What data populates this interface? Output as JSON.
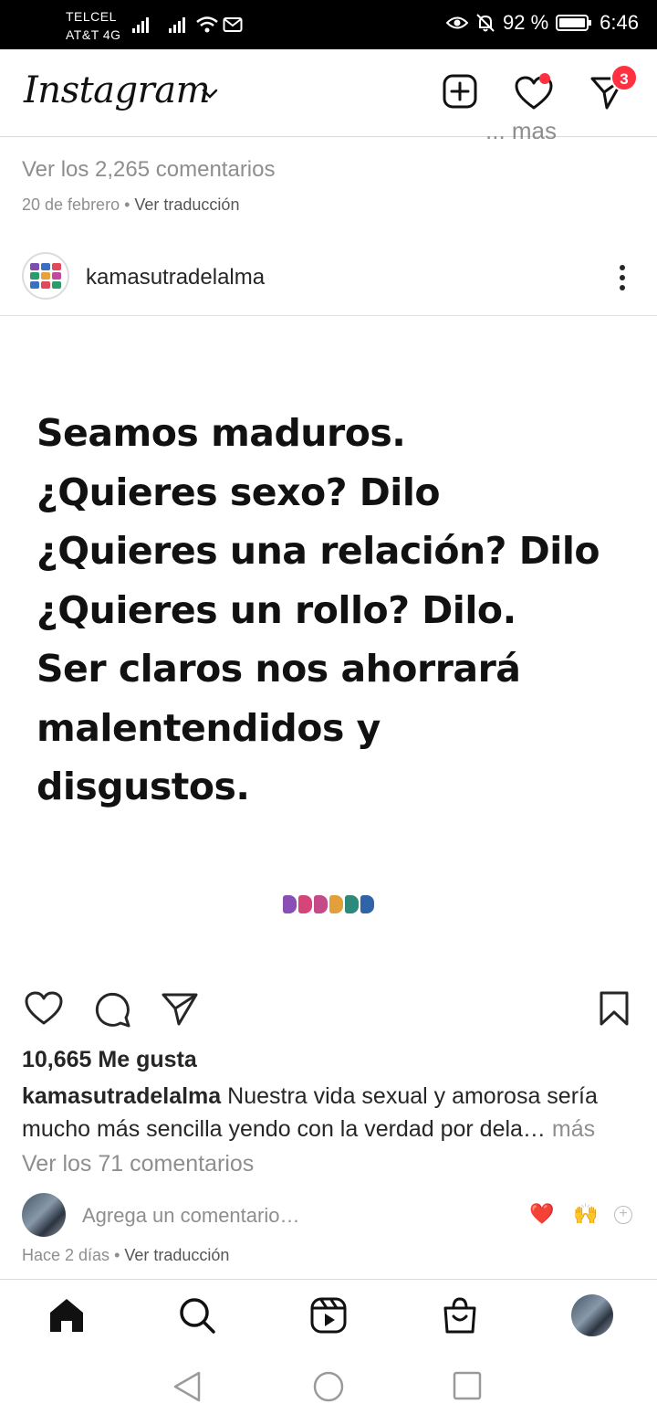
{
  "status_bar": {
    "carrier_1": "TELCEL",
    "carrier_2": "AT&T 4G",
    "battery": "92 %",
    "time": "6:46"
  },
  "header": {
    "logo": "Instagram",
    "messages_badge": "3",
    "icons": [
      "new-post-icon",
      "heart-icon",
      "direct-message-icon"
    ]
  },
  "previous_post": {
    "truncated_more": "... más",
    "view_comments": "Ver los 2,265 comentarios",
    "date": "20 de febrero",
    "separator": " • ",
    "translate": "Ver traducción"
  },
  "post": {
    "username": "kamasutradelalma",
    "image_text": [
      "Seamos maduros.",
      "¿Quieres sexo? Dilo",
      "¿Quieres una relación? Dilo",
      "¿Quieres un rollo? Dilo.",
      "Ser claros nos ahorrará",
      "malentendidos y",
      "disgustos."
    ],
    "likes": "10,665 Me gusta",
    "caption_user": "kamasutradelalma",
    "caption_text": " Nuestra vida sexual y amorosa sería mucho más sencilla yendo con la verdad por dela… ",
    "caption_more": "más",
    "view_comments": "Ver los 71 comentarios",
    "add_comment_placeholder": "Agrega un comentario…",
    "quick_emojis": [
      "❤️",
      "🙌"
    ],
    "time_ago": "Hace 2 días",
    "separator": " • ",
    "translate": "Ver traducción"
  },
  "bottom_nav": [
    "home-icon",
    "search-icon",
    "reels-icon",
    "shop-icon",
    "profile-avatar"
  ],
  "colors": {
    "accent_red": "#ff3040",
    "muted_text": "#8e8e8e",
    "primary_text": "#262626"
  }
}
